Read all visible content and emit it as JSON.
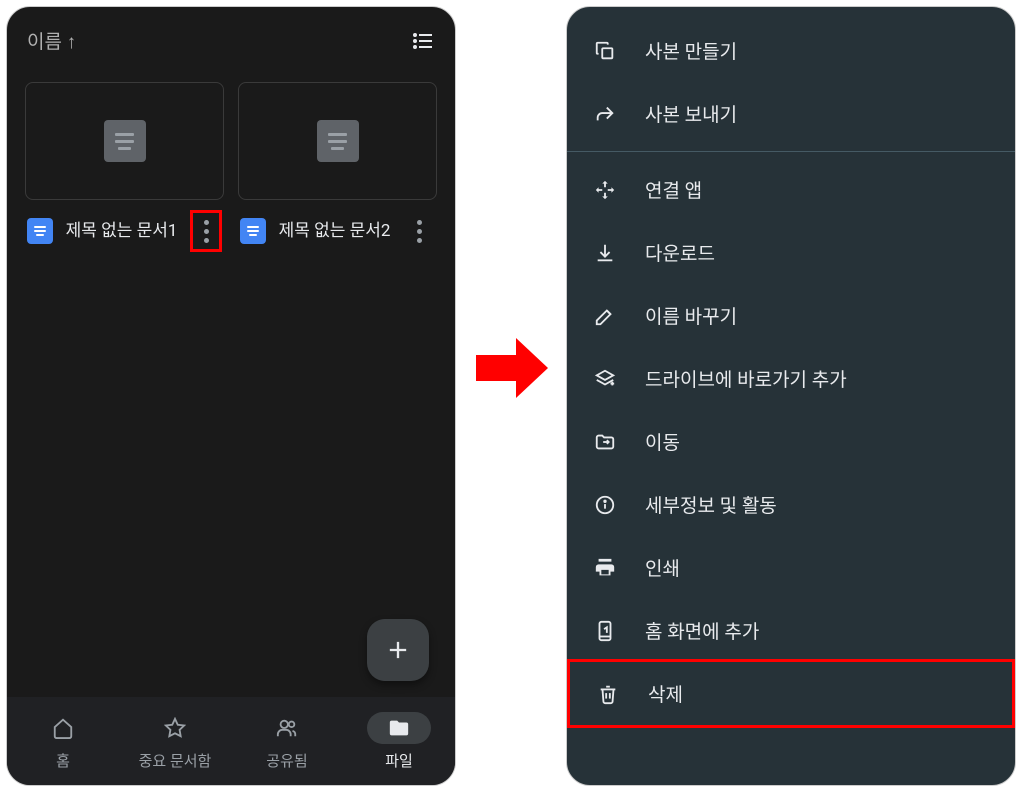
{
  "left": {
    "sort_label": "이름 ↑",
    "documents": [
      {
        "title": "제목 없는 문서1"
      },
      {
        "title": "제목 없는 문서2"
      }
    ],
    "nav": [
      {
        "label": "홈"
      },
      {
        "label": "중요 문서함"
      },
      {
        "label": "공유됨"
      },
      {
        "label": "파일"
      }
    ]
  },
  "menu": {
    "items": [
      {
        "icon": "copy",
        "label": "사본 만들기"
      },
      {
        "icon": "send",
        "label": "사본 보내기"
      },
      {
        "divider": true
      },
      {
        "icon": "open-with",
        "label": "연결 앱"
      },
      {
        "icon": "download",
        "label": "다운로드"
      },
      {
        "icon": "rename",
        "label": "이름 바꾸기"
      },
      {
        "icon": "shortcut",
        "label": "드라이브에 바로가기 추가"
      },
      {
        "icon": "move",
        "label": "이동"
      },
      {
        "icon": "info",
        "label": "세부정보 및 활동"
      },
      {
        "icon": "print",
        "label": "인쇄"
      },
      {
        "icon": "add-home",
        "label": "홈 화면에 추가"
      },
      {
        "icon": "delete",
        "label": "삭제",
        "highlighted": true
      }
    ]
  }
}
